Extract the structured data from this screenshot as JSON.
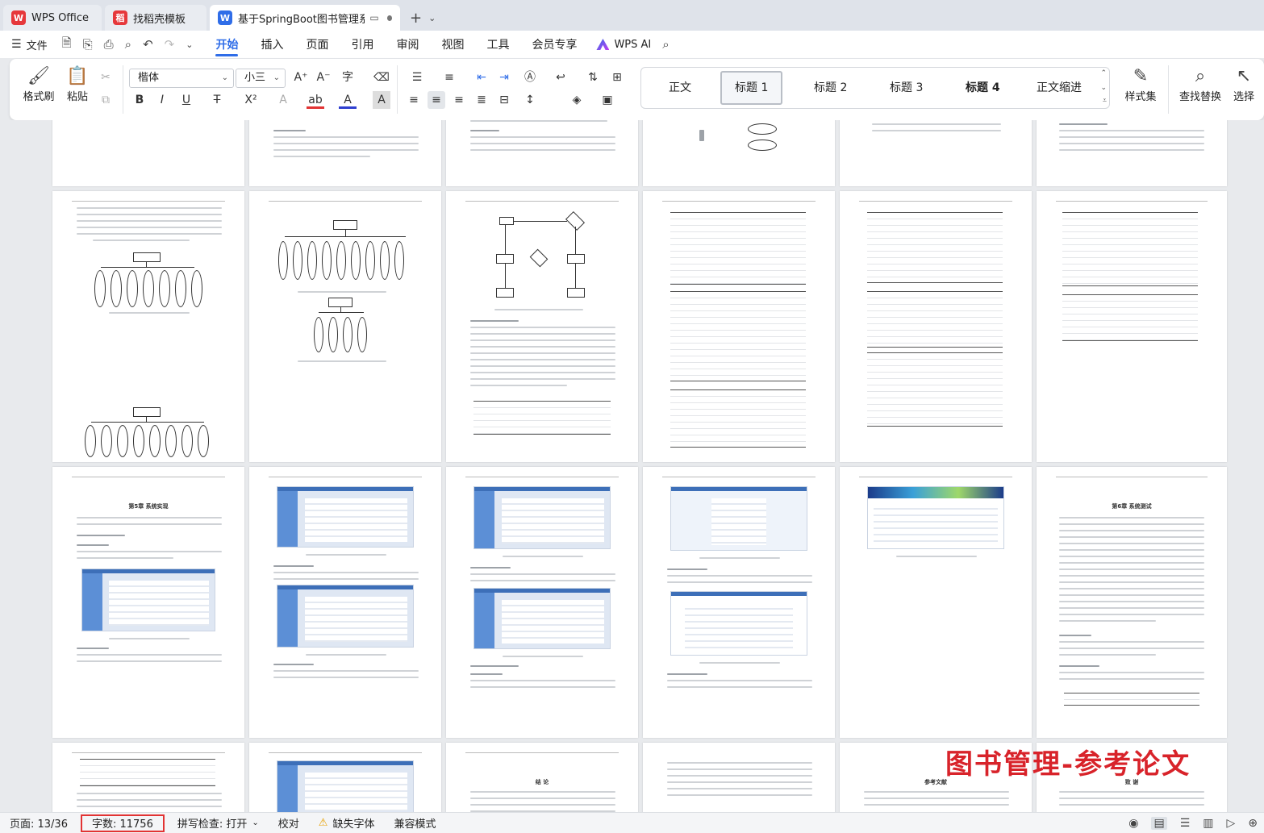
{
  "tabs": [
    {
      "label": "WPS Office",
      "logo_text": "W",
      "color": "#e6383b"
    },
    {
      "label": "找稻壳模板",
      "logo_text": "稻",
      "color": "#e6383b"
    },
    {
      "label": "基于SpringBoot图书管理系统",
      "logo_text": "W",
      "color": "#2f6de8"
    }
  ],
  "menubar": {
    "file_label": "文件",
    "tabs": [
      "开始",
      "插入",
      "页面",
      "引用",
      "审阅",
      "视图",
      "工具",
      "会员专享"
    ],
    "active_tab": "开始",
    "ai_label": "WPS AI"
  },
  "ribbon": {
    "format_painter": "格式刷",
    "paste": "粘贴",
    "font_name": "楷体",
    "font_size": "小三",
    "styles": [
      "正文",
      "标题 1",
      "标题 2",
      "标题 3",
      "标题 4",
      "正文缩进"
    ],
    "selected_style": "标题 1",
    "style_set": "样式集",
    "find_replace": "查找替换",
    "select": "选择"
  },
  "page_texts": {
    "chapter5": "第5章 系统实现",
    "chapter6": "第6章 系统测试",
    "conclusion": "结 论",
    "references": "参考文献",
    "thanks": "致 谢"
  },
  "watermark": "图书管理-参考论文",
  "statusbar": {
    "page": "页面: 13/36",
    "word_count": "字数: 11756",
    "spell_check": "拼写检查: 打开",
    "proofread": "校对",
    "missing_font": "缺失字体",
    "compat_mode": "兼容模式"
  }
}
